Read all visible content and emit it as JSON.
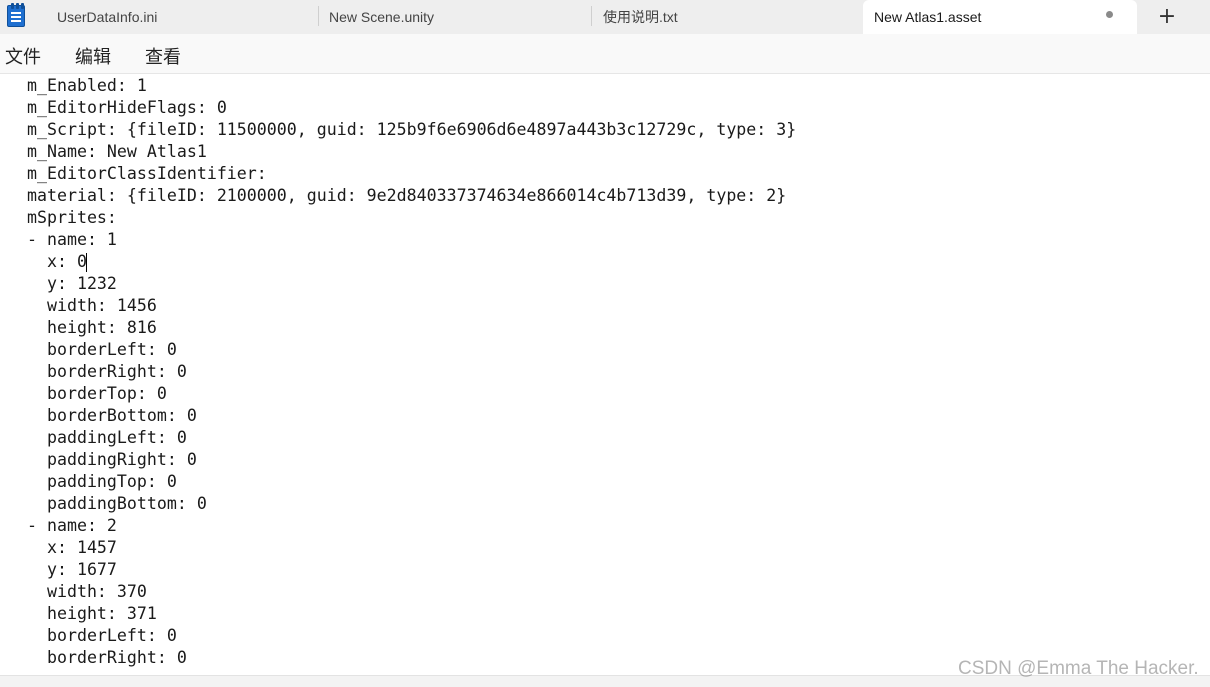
{
  "tabs": [
    {
      "label": "UserDataInfo.ini",
      "active": false
    },
    {
      "label": "New Scene.unity",
      "active": false
    },
    {
      "label": "使用说明.txt",
      "active": false
    },
    {
      "label": "New Atlas1.asset",
      "active": true,
      "unsaved": true
    }
  ],
  "new_tab_symbol": "+",
  "menu": {
    "file": "文件",
    "edit": "编辑",
    "view": "查看"
  },
  "editor": {
    "lines": [
      "m_Enabled: 1",
      "m_EditorHideFlags: 0",
      "m_Script: {fileID: 11500000, guid: 125b9f6e6906d6e4897a443b3c12729c, type: 3}",
      "m_Name: New Atlas1",
      "m_EditorClassIdentifier:",
      "material: {fileID: 2100000, guid: 9e2d840337374634e866014c4b713d39, type: 2}",
      "mSprites:",
      "- name: 1",
      "  x: 0",
      "  y: 1232",
      "  width: 1456",
      "  height: 816",
      "  borderLeft: 0",
      "  borderRight: 0",
      "  borderTop: 0",
      "  borderBottom: 0",
      "  paddingLeft: 0",
      "  paddingRight: 0",
      "  paddingTop: 0",
      "  paddingBottom: 0",
      "- name: 2",
      "  x: 1457",
      "  y: 1677",
      "  width: 370",
      "  height: 371",
      "  borderLeft: 0",
      "  borderRight: 0"
    ]
  },
  "watermark": "CSDN @Emma The Hacker.",
  "colors": {
    "tabbar": "#eeeeee",
    "active_tab": "#ffffff",
    "menubar": "#f9f9f9",
    "icon": "#1e6fd0"
  }
}
